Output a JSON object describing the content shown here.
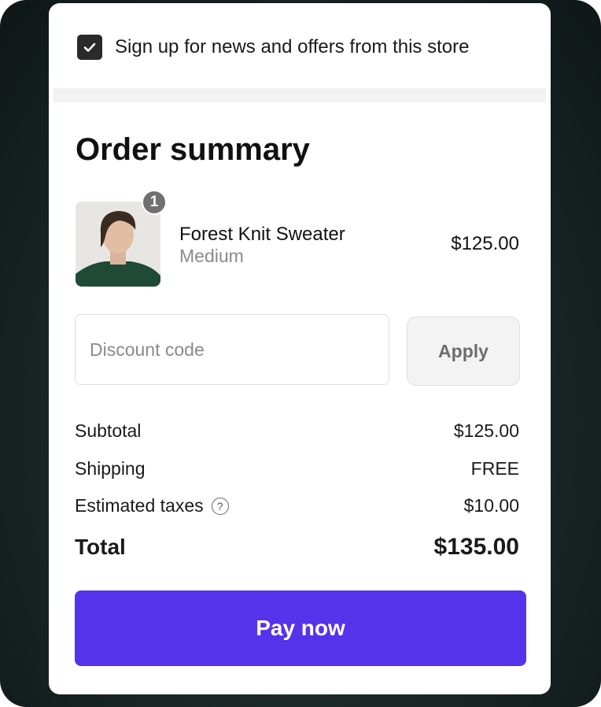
{
  "newsletter": {
    "label": "Sign up for news and offers from this store",
    "checked": true
  },
  "order_summary": {
    "title": "Order summary",
    "item": {
      "name": "Forest Knit Sweater",
      "variant": "Medium",
      "price": "$125.00",
      "quantity": "1"
    },
    "discount": {
      "placeholder": "Discount code",
      "apply_label": "Apply"
    },
    "subtotal": {
      "label": "Subtotal",
      "value": "$125.00"
    },
    "shipping": {
      "label": "Shipping",
      "value": "FREE"
    },
    "taxes": {
      "label": "Estimated taxes",
      "value": "$10.00"
    },
    "total": {
      "label": "Total",
      "value": "$135.00"
    },
    "pay_label": "Pay now"
  },
  "colors": {
    "pay_button": "#5433eb",
    "frame": "#1a2626"
  }
}
